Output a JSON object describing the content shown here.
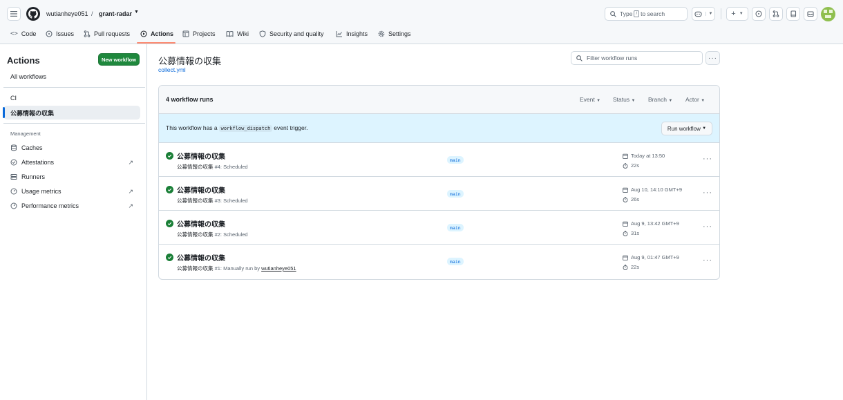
{
  "header": {
    "owner": "wutianheye051",
    "separator": "/",
    "repo": "grant-radar",
    "search_prefix": "Type",
    "search_key": "/",
    "search_suffix": "to search"
  },
  "tabs": [
    {
      "label": "Code",
      "icon": "code-icon"
    },
    {
      "label": "Issues",
      "icon": "issue-opened-icon"
    },
    {
      "label": "Pull requests",
      "icon": "git-pull-request-icon"
    },
    {
      "label": "Actions",
      "icon": "play-icon",
      "active": true
    },
    {
      "label": "Projects",
      "icon": "table-icon"
    },
    {
      "label": "Wiki",
      "icon": "book-icon"
    },
    {
      "label": "Security and quality",
      "icon": "shield-icon"
    },
    {
      "label": "Insights",
      "icon": "graph-icon"
    },
    {
      "label": "Settings",
      "icon": "gear-icon"
    }
  ],
  "sidebar": {
    "title": "Actions",
    "new_workflow": "New workflow",
    "all_workflows": "All workflows",
    "ci_label": "CI",
    "selected_workflow": "公募情報の収集",
    "management_label": "Management",
    "management_items": [
      {
        "label": "Caches",
        "icon": "database-icon",
        "external": false
      },
      {
        "label": "Attestations",
        "icon": "verified-icon",
        "external": true
      },
      {
        "label": "Runners",
        "icon": "server-icon",
        "external": false
      },
      {
        "label": "Usage metrics",
        "icon": "meter-icon",
        "external": true
      },
      {
        "label": "Performance metrics",
        "icon": "meter-icon",
        "external": true
      }
    ]
  },
  "main": {
    "title": "公募情報の収集",
    "file": "collect.yml",
    "filter_placeholder": "Filter workflow runs",
    "runs_count": "4 workflow runs",
    "filters": [
      "Event",
      "Status",
      "Branch",
      "Actor"
    ],
    "notice_prefix": "This workflow has a",
    "notice_code": "workflow_dispatch",
    "notice_suffix": "event trigger.",
    "run_workflow": "Run workflow"
  },
  "runs": [
    {
      "title": "公募情報の収集",
      "workflow": "公募情報の収集",
      "detail": "#4: Scheduled",
      "actor": "",
      "branch": "main",
      "date": "Today at 13:50",
      "duration": "22s",
      "status": "success"
    },
    {
      "title": "公募情報の収集",
      "workflow": "公募情報の収集",
      "detail": "#3: Scheduled",
      "actor": "",
      "branch": "main",
      "date": "Aug 10, 14:10 GMT+9",
      "duration": "26s",
      "status": "success"
    },
    {
      "title": "公募情報の収集",
      "workflow": "公募情報の収集",
      "detail": "#2: Scheduled",
      "actor": "",
      "branch": "main",
      "date": "Aug 9, 13:42 GMT+9",
      "duration": "31s",
      "status": "success"
    },
    {
      "title": "公募情報の収集",
      "workflow": "公募情報の収集",
      "detail": "#1: Manually run by",
      "actor": "wutianheye051",
      "branch": "main",
      "date": "Aug 9, 01:47 GMT+9",
      "duration": "22s",
      "status": "success"
    }
  ],
  "colors": {
    "accent": "#0969da",
    "success": "#1a7f37",
    "primary_button": "#1f883d",
    "tab_underline": "#fd8c73",
    "notice_bg": "#ddf4ff"
  }
}
